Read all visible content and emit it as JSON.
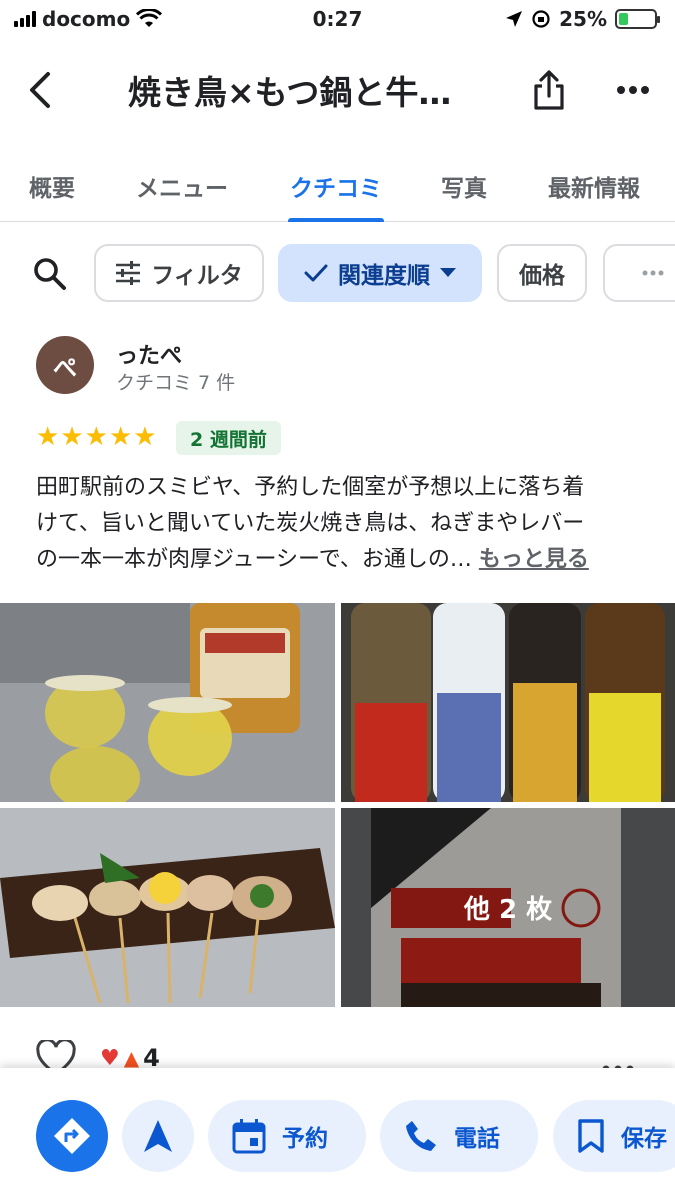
{
  "status_bar": {
    "carrier": "docomo",
    "time": "0:27",
    "battery_percent": "25%",
    "battery_level": 0.25
  },
  "header": {
    "title": "焼き鳥×もつ鍋と牛…"
  },
  "tabs": [
    {
      "label": "概要"
    },
    {
      "label": "メニュー"
    },
    {
      "label": "クチコミ"
    },
    {
      "label": "写真"
    },
    {
      "label": "最新情報"
    }
  ],
  "active_tab": "クチコミ",
  "filters": {
    "filter_label": "フィルタ",
    "sort_label": "関連度順",
    "price_label": "価格"
  },
  "review": {
    "avatar_initial": "ぺ",
    "reviewer_name": "ったぺ",
    "reviewer_meta": "クチコミ 7 件",
    "rating": 5,
    "stars": [
      "★",
      "★",
      "★",
      "★",
      "★"
    ],
    "time_ago": "2 週間前",
    "text_lines": [
      "田町駅前のスミビヤ、予約した個室が予想以上に落ち着",
      "けて、旨いと聞いていた炭火焼き鳥は、ねぎまやレバー",
      "の一本一本が肉厚ジューシーで、お通しの…"
    ],
    "more_label": "もっと見る",
    "photo_more_label": "他 2 枚",
    "reaction_count": "4"
  },
  "actions": {
    "reserve_label": "予約",
    "call_label": "電話",
    "save_label": "保存"
  },
  "colors": {
    "accent": "#1a73e8",
    "star": "#fbbc04",
    "badge_bg": "#e6f4ea",
    "badge_text": "#137333",
    "chip_selected": "#d3e3fd",
    "avatar": "#6d4c41"
  }
}
